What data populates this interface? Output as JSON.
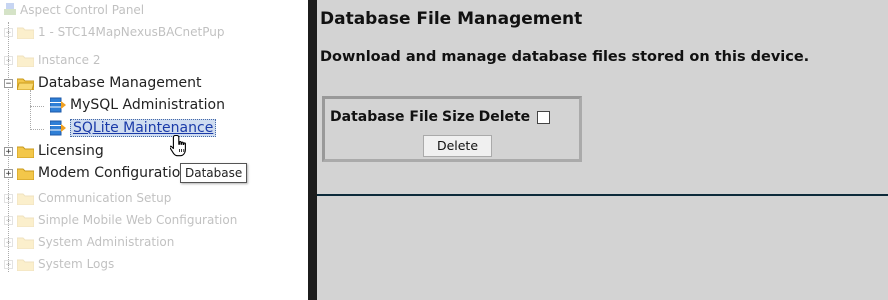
{
  "tree": {
    "root": "Aspect Control Panel",
    "items": [
      {
        "label": "1 - STC14MapNexusBACnetPup",
        "dim": true
      },
      {
        "label": "Instance 2",
        "dim": true
      },
      {
        "label": "Database Management",
        "dim": false,
        "expanded": true,
        "children": [
          {
            "label": "MySQL Administration"
          },
          {
            "label": "SQLite Maintenance",
            "selected": true
          }
        ]
      },
      {
        "label": "Licensing",
        "dim": false
      },
      {
        "label": "Modem Configuration",
        "dim": false
      },
      {
        "label": "Communication Setup",
        "dim": true
      },
      {
        "label": "Simple Mobile Web Configuration",
        "dim": true
      },
      {
        "label": "System Administration",
        "dim": true
      },
      {
        "label": "System Logs",
        "dim": true
      }
    ]
  },
  "tooltip": "Database",
  "main": {
    "title": "Database File Management",
    "description": "Download and manage database files stored on this device.",
    "table": {
      "col_file": "Database File",
      "col_size": "Size",
      "col_delete": "Delete",
      "delete_button": "Delete"
    }
  },
  "colors": {
    "main_bg": "#d3d3d3",
    "splitter": "#1c1c1c",
    "selected_link": "#1a3aa8",
    "folder": "#f3c74a"
  }
}
